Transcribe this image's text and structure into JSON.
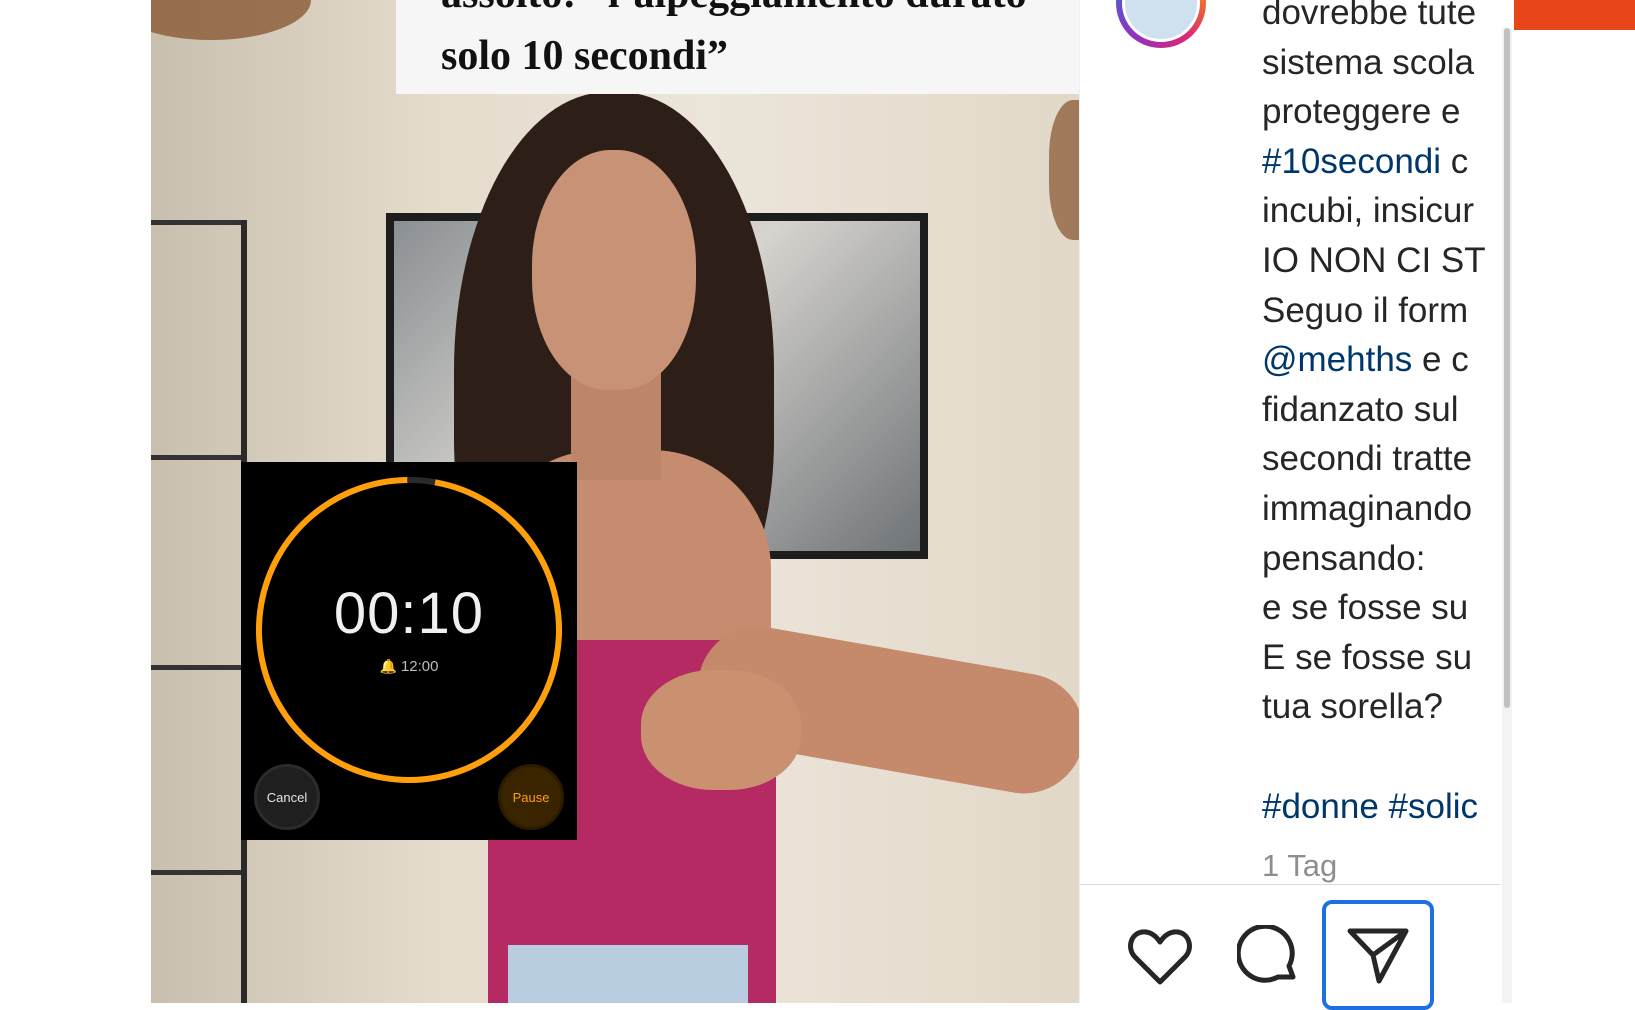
{
  "video": {
    "caption_line1": "assolto: “l’alpeggiamento durato",
    "caption_line2": "solo 10 secondi”"
  },
  "timer": {
    "time": "00:10",
    "alarm_time": "12:00",
    "cancel_label": "Cancel",
    "pause_label": "Pause",
    "ring_color": "#ff9f0a",
    "progress_fraction": 0.97
  },
  "post": {
    "lines": [
      {
        "text": "dovrebbe tute",
        "type": "text"
      },
      {
        "text": "sistema scola",
        "type": "text"
      },
      {
        "text": "proteggere e",
        "type": "text"
      },
      {
        "text": "#10secondi",
        "type": "link",
        "rest": " c"
      },
      {
        "text": "incubi, insicur",
        "type": "text"
      },
      {
        "text": "IO NON CI ST",
        "type": "text"
      },
      {
        "text": "Seguo il form",
        "type": "text"
      },
      {
        "text": "@mehths",
        "type": "link",
        "rest": " e c"
      },
      {
        "text": "fidanzato sul",
        "type": "text"
      },
      {
        "text": "secondi tratte",
        "type": "text"
      },
      {
        "text": "immaginando",
        "type": "text"
      },
      {
        "text": "pensando:",
        "type": "text"
      },
      {
        "text": "e se fosse su",
        "type": "text"
      },
      {
        "text": "E se fosse su",
        "type": "text"
      },
      {
        "text": "tua sorella?",
        "type": "text"
      },
      {
        "text": "",
        "type": "text"
      },
      {
        "text": "#donne #solic",
        "type": "link"
      }
    ],
    "time_ago": "1 Tag"
  },
  "actions": {
    "like": "heart-icon",
    "comment": "comment-icon",
    "share": "send-icon"
  },
  "colors": {
    "link": "#00376b",
    "accent_orange": "#e8461a",
    "focus_blue": "#1f6fe0"
  }
}
